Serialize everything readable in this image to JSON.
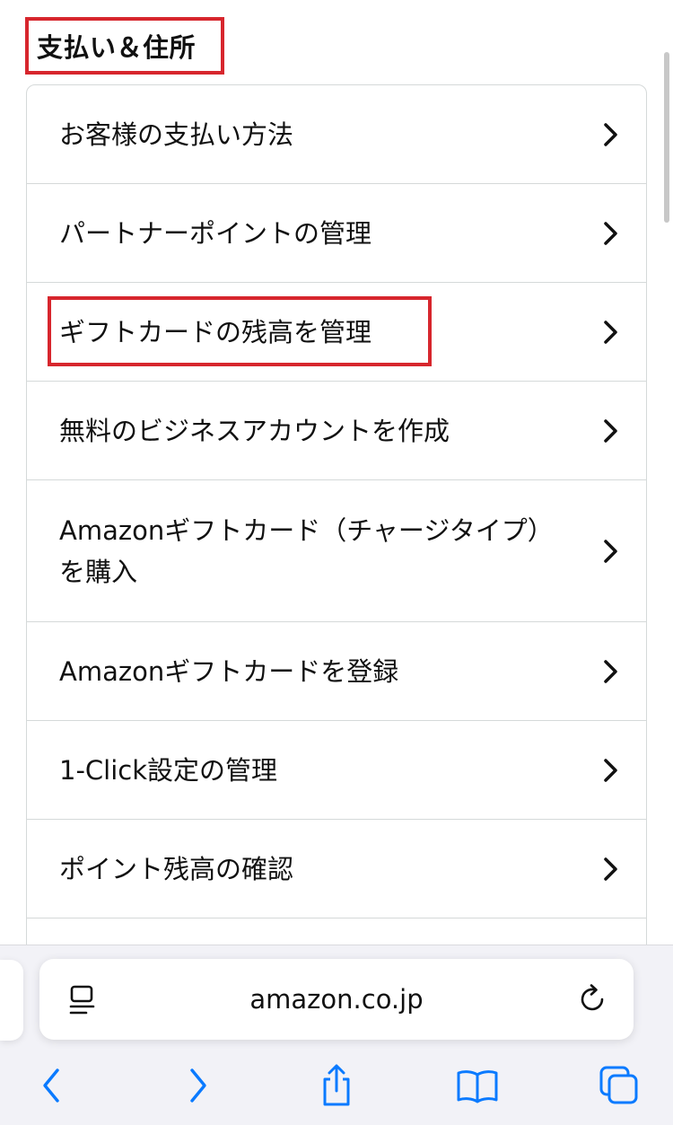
{
  "section": {
    "title": "支払い＆住所"
  },
  "menu": {
    "items": [
      {
        "label": "お客様の支払い方法"
      },
      {
        "label": "パートナーポイントの管理"
      },
      {
        "label": "ギフトカードの残高を管理"
      },
      {
        "label": "無料のビジネスアカウントを作成"
      },
      {
        "label": "Amazonギフトカード（チャージタイプ）を購入"
      },
      {
        "label": "Amazonギフトカードを登録"
      },
      {
        "label": "1-Click設定の管理"
      },
      {
        "label": "ポイント残高の確認"
      }
    ]
  },
  "browser": {
    "url": "amazon.co.jp"
  },
  "icons": {
    "reader": "reader-mode-icon",
    "reload": "reload-icon",
    "back": "back-arrow-icon",
    "forward": "forward-arrow-icon",
    "share": "share-icon",
    "bookmarks": "bookmarks-icon",
    "tabs": "tabs-icon",
    "chevron": "chevron-right-icon"
  },
  "colors": {
    "highlight": "#d7262d",
    "ios_blue": "#0a7aff",
    "border": "#d5d9d9"
  }
}
